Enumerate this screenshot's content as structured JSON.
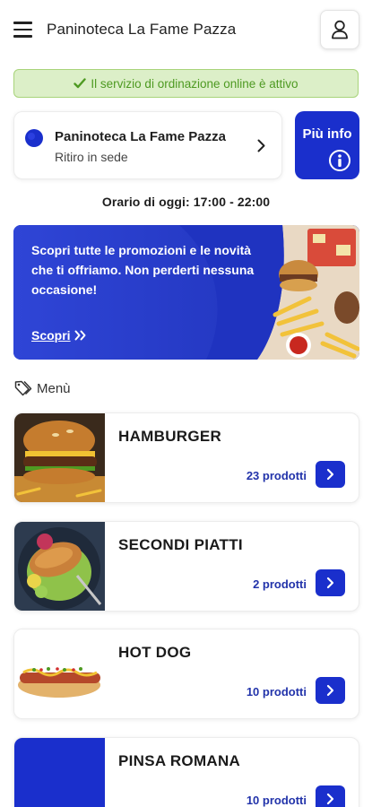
{
  "header": {
    "title": "Paninoteca La Fame Pazza",
    "menu_icon": "hamburger-menu-icon",
    "user_icon": "user-icon"
  },
  "service_banner": {
    "text": "Il servizio di ordinazione online è attivo",
    "icon": "check-icon",
    "color": "#4e9a22"
  },
  "store": {
    "name": "Paninoteca La Fame Pazza",
    "mode": "Ritiro in sede",
    "icon": "store-marker-icon"
  },
  "info_button": {
    "label": "Più info",
    "icon": "info-icon"
  },
  "hours": {
    "text": "Orario di oggi: 17:00 - 22:00"
  },
  "promo": {
    "text": "Scopri tutte le promozioni e le novità che ti offriamo. Non perderti nessuna occasione!",
    "link": "Scopri",
    "link_icon": "double-chevron-right-icon"
  },
  "menu": {
    "label": "Menù",
    "icon": "tag-icon",
    "categories": [
      {
        "name": "HAMBURGER",
        "count": "23 prodotti"
      },
      {
        "name": "SECONDI PIATTI",
        "count": "2 prodotti"
      },
      {
        "name": "HOT DOG",
        "count": "10 prodotti"
      },
      {
        "name": "PINSA ROMANA",
        "count": "10 prodotti"
      }
    ]
  },
  "colors": {
    "accent": "#1a2fcc",
    "promo_bg": "#2f45d6",
    "success_bg": "#dcefc8",
    "success_border": "#a8d47a"
  }
}
